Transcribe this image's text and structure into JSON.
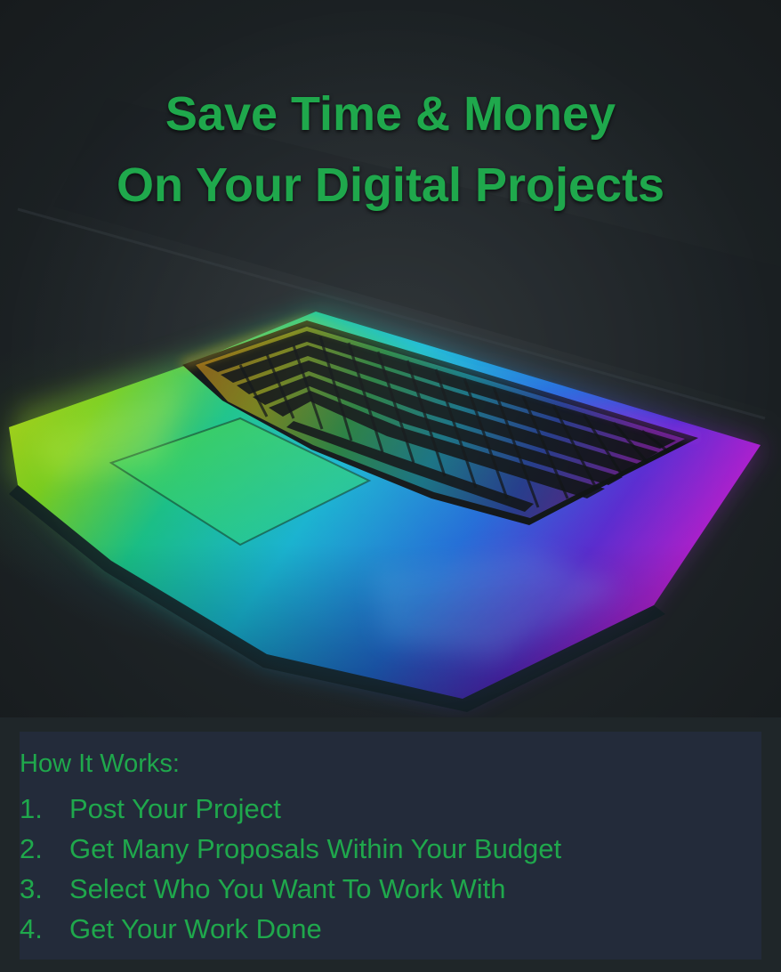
{
  "headline": {
    "line1": "Save Time & Money",
    "line2": "On Your Digital Projects"
  },
  "how_it_works": {
    "title": "How It Works:",
    "steps": [
      {
        "num": "1.",
        "text": "Post Your Project"
      },
      {
        "num": "2.",
        "text": "Get Many Proposals Within Your Budget"
      },
      {
        "num": "3.",
        "text": "Select Who You Want To Work With"
      },
      {
        "num": "4.",
        "text": "Get Your Work Done"
      }
    ]
  },
  "colors": {
    "headline_green": "#1fa84c",
    "background_dark": "#1d2225",
    "panel_navy": "#232b3a"
  },
  "image": {
    "subject": "laptop-with-rainbow-backlit-keyboard"
  }
}
